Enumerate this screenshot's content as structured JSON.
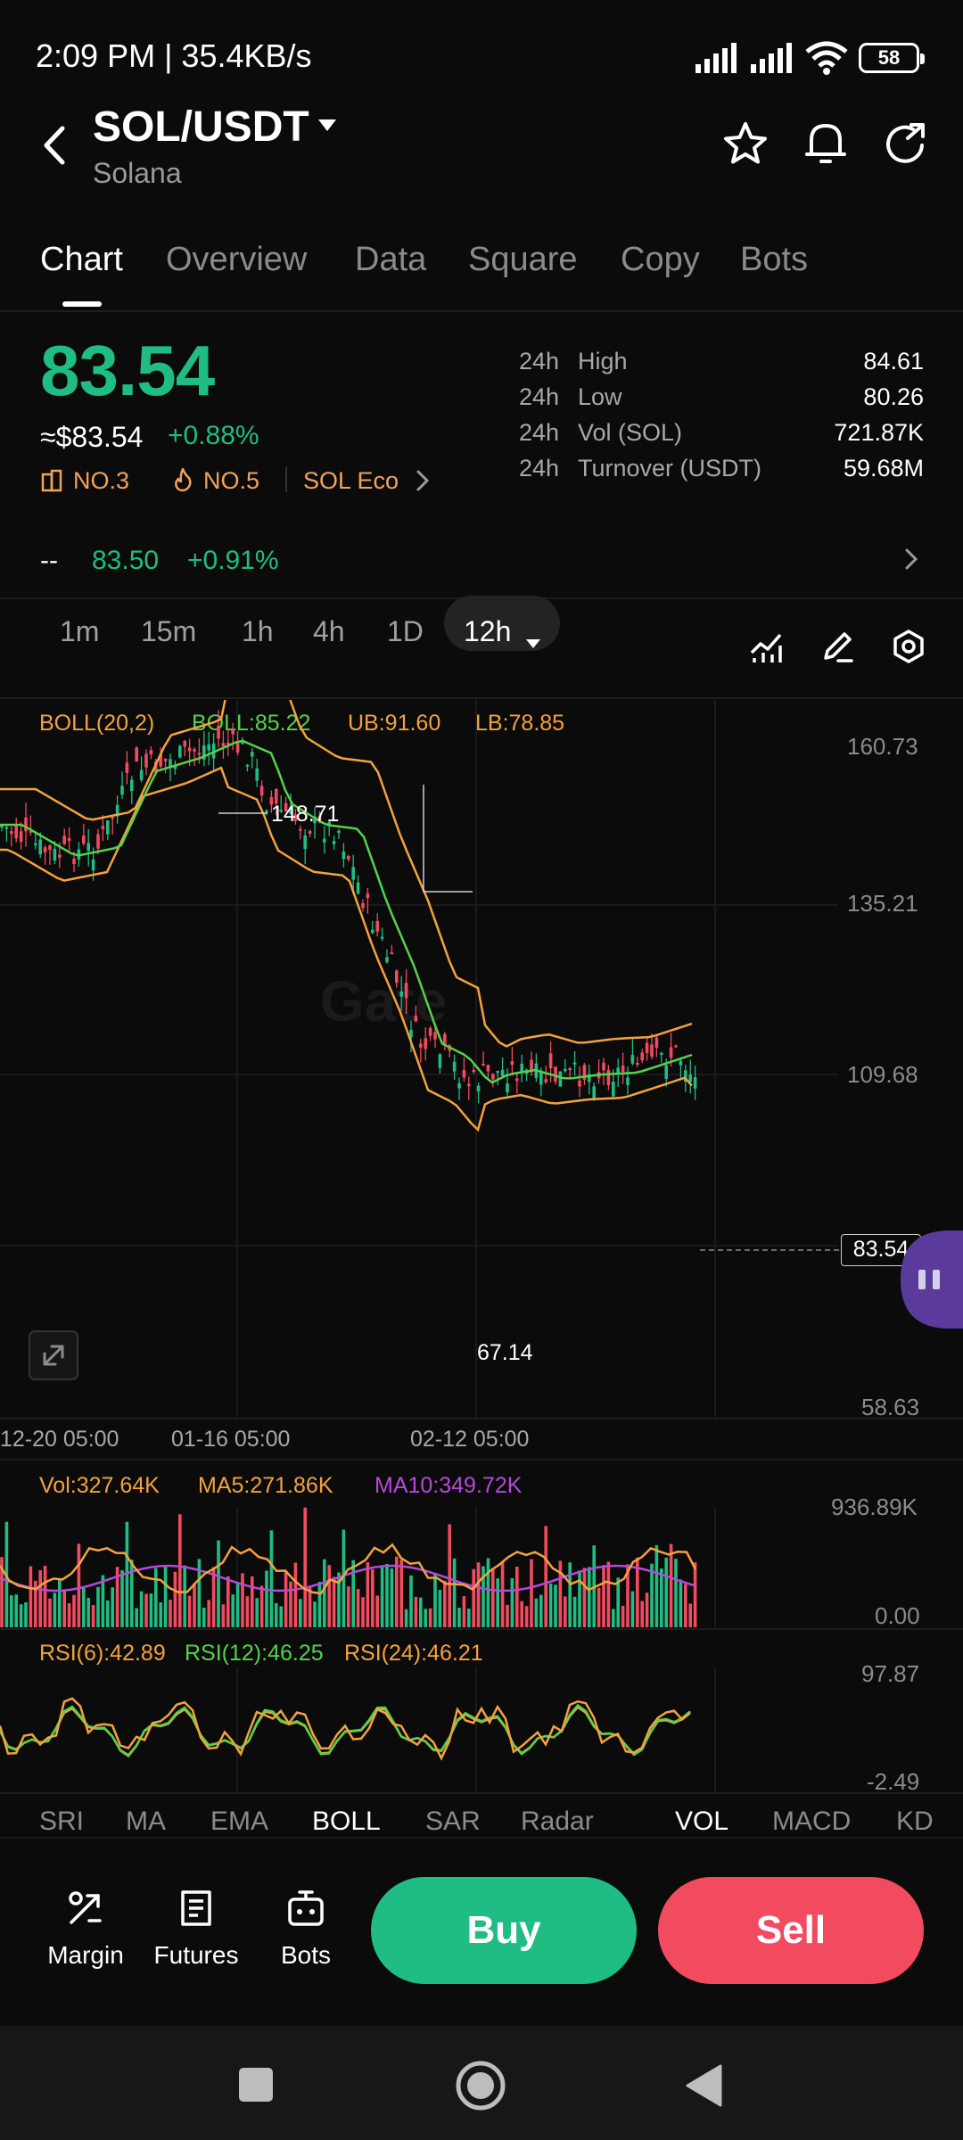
{
  "status_bar": {
    "time": "2:09 PM | 35.4KB/s",
    "battery": "58"
  },
  "header": {
    "pair": "SOL/USDT",
    "name": "Solana"
  },
  "tabs": [
    {
      "label": "Chart",
      "active": true
    },
    {
      "label": "Overview"
    },
    {
      "label": "Data"
    },
    {
      "label": "Square"
    },
    {
      "label": "Copy"
    },
    {
      "label": "Bots"
    }
  ],
  "ticker": {
    "price": "83.54",
    "usd_price": "≈$83.54",
    "change": "+0.88%",
    "rank1": "NO.3",
    "rank2": "NO.5",
    "eco": "SOL Eco",
    "stats": [
      {
        "prefix": "24h",
        "label": "High",
        "value": "84.61"
      },
      {
        "prefix": "24h",
        "label": "Low",
        "value": "80.26"
      },
      {
        "prefix": "24h",
        "label": "Vol (SOL)",
        "value": "721.87K"
      },
      {
        "prefix": "24h",
        "label": "Turnover (USDT)",
        "value": "59.68M"
      }
    ]
  },
  "sub_row": {
    "dash": "--",
    "price": "83.50",
    "change": "+0.91%"
  },
  "timeframes": [
    "1m",
    "15m",
    "1h",
    "4h",
    "1D",
    "12h"
  ],
  "active_timeframe": "12h",
  "chart": {
    "legend": {
      "boll": "BOLL(20,2)",
      "mid": "BOLL:85.22",
      "ub": "UB:91.60",
      "lb": "LB:78.85"
    },
    "y_labels": [
      "160.73",
      "135.21",
      "109.68",
      "58.63"
    ],
    "current_price_tag": "83.54",
    "high_marker": "148.71",
    "low_marker": "67.14",
    "x_labels": [
      "12-20 05:00",
      "01-16 05:00",
      "02-12 05:00"
    ],
    "watermark": "Gate"
  },
  "volume": {
    "vol": "Vol:327.64K",
    "ma5": "MA5:271.86K",
    "ma10": "MA10:349.72K",
    "y_max": "936.89K",
    "y_min": "0.00"
  },
  "rsi": {
    "rsi6": "RSI(6):42.89",
    "rsi12": "RSI(12):46.25",
    "rsi24": "RSI(24):46.21",
    "y_max": "97.87",
    "y_min": "-2.49"
  },
  "indicator_tabs": [
    "SRI",
    "MA",
    "EMA",
    "BOLL",
    "SAR",
    "Radar",
    "VOL",
    "MACD",
    "KD"
  ],
  "actions": {
    "margin": "Margin",
    "futures": "Futures",
    "bots": "Bots",
    "buy": "Buy",
    "sell": "Sell"
  },
  "colors": {
    "up": "#1fbd83",
    "down": "#f24a5f",
    "boll_band": "#f3a23e",
    "boll_mid": "#54d24b",
    "ma10": "#b54ad8"
  }
}
